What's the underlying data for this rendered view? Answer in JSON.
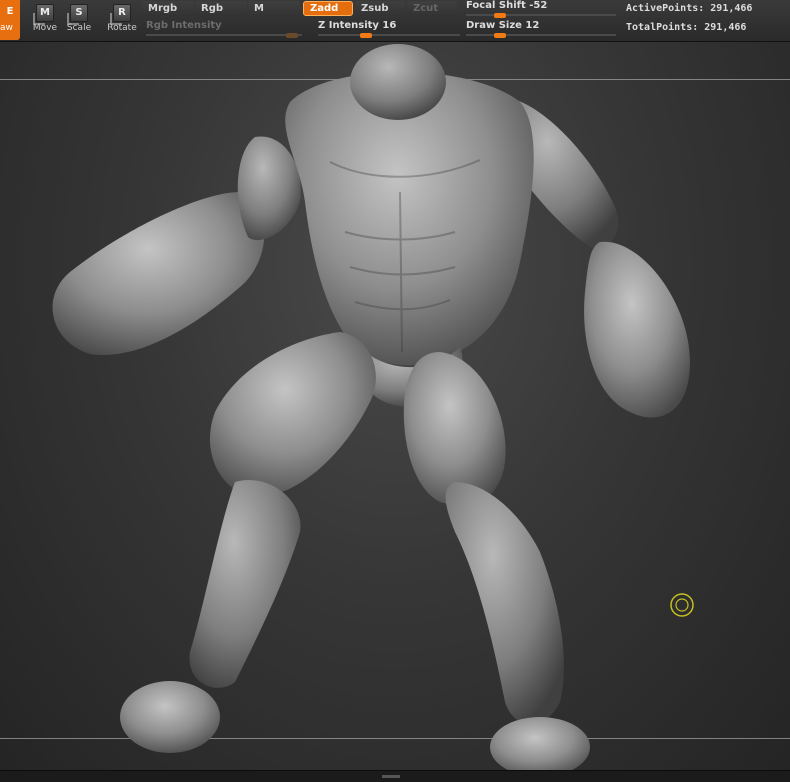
{
  "toolbar": {
    "draw_label": "aw",
    "draw_icon": "E",
    "move_label": "Move",
    "move_key": "M",
    "scale_label": "Scale",
    "scale_key": "S",
    "rotate_label": "Rotate",
    "rotate_key": "R",
    "mrgb": "Mrgb",
    "rgb": "Rgb",
    "m": "M",
    "zadd": "Zadd",
    "zsub": "Zsub",
    "zcut": "Zcut",
    "rgb_intensity": "Rgb  Intensity",
    "z_intensity": "Z  Intensity 16",
    "focal_shift": "Focal  Shift -52",
    "draw_size": "Draw  Size 12",
    "active_points": "ActivePoints: 291,466",
    "total_points": "TotalPoints: 291,466",
    "accent_color": "#e46d0e",
    "z_intensity_value": 16,
    "focal_shift_value": -52,
    "draw_size_value": 12
  },
  "canvas": {
    "model": "sculpted humanoid mesh",
    "cursor_color": "#c8c020",
    "icons": [
      "brush-cursor-icon"
    ]
  }
}
